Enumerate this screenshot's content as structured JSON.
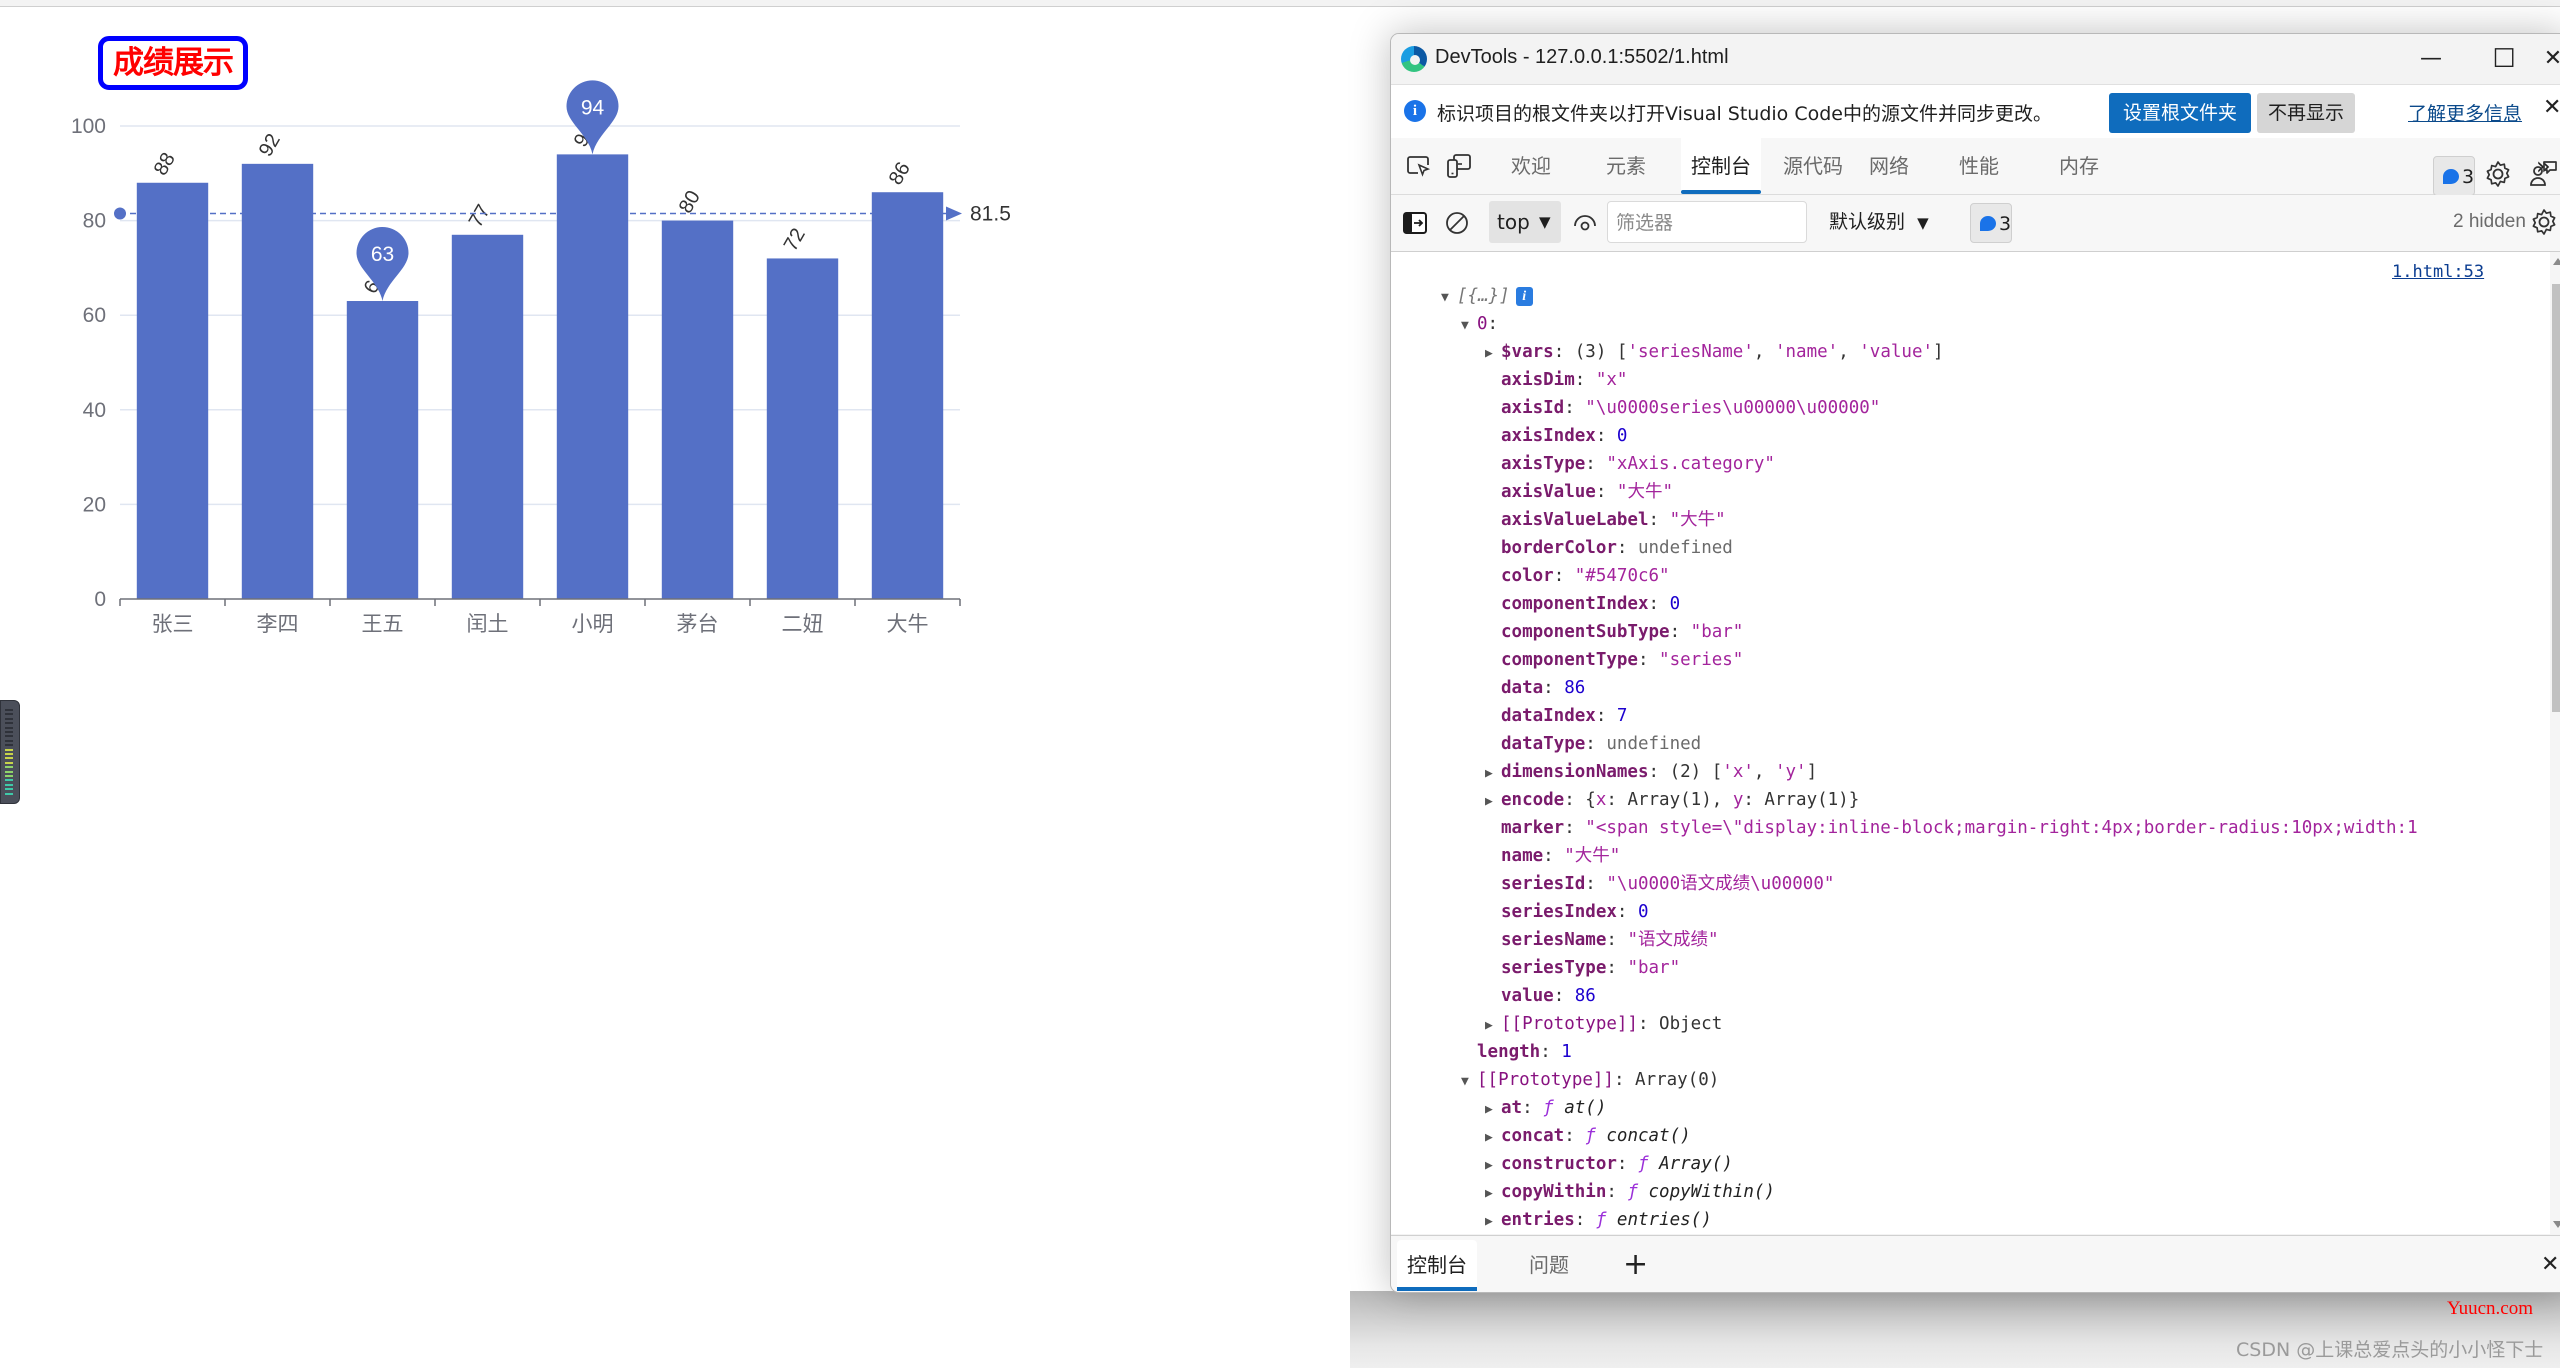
{
  "page": {
    "title_badge": "成绩展示"
  },
  "chart_data": {
    "type": "bar",
    "title": "成绩展示",
    "series_name": "语文成绩",
    "color": "#5470c6",
    "categories": [
      "张三",
      "李四",
      "王五",
      "闰土",
      "小明",
      "茅台",
      "二妞",
      "大牛"
    ],
    "values": [
      88,
      92,
      63,
      77,
      94,
      80,
      72,
      86
    ],
    "value_labels_rotated": true,
    "ylim": [
      0,
      100
    ],
    "yticks": [
      0,
      20,
      40,
      60,
      80,
      100
    ],
    "grid": true,
    "mark_points": [
      {
        "type": "min",
        "category": "王五",
        "value": 63,
        "label": "63"
      },
      {
        "type": "max",
        "category": "小明",
        "value": 94,
        "label": "94"
      }
    ],
    "mark_line": {
      "type": "average",
      "value": 81.5,
      "label": "81.5"
    },
    "xlabel": "",
    "ylabel": ""
  },
  "devtools": {
    "window_title": "DevTools - 127.0.0.1:5502/1.html",
    "window_buttons": {
      "minimize": "—",
      "maximize": "☐",
      "close": "✕"
    },
    "infobar": {
      "text": "标识项目的根文件夹以打开Visual Studio Code中的源文件并同步更改。",
      "primary_button": "设置根文件夹",
      "secondary_button": "不再显示",
      "link": "了解更多信息",
      "close": "✕"
    },
    "tabs": [
      {
        "label": "欢迎",
        "active": false
      },
      {
        "label": "元素",
        "active": false
      },
      {
        "label": "控制台",
        "active": true
      },
      {
        "label": "源代码",
        "active": false
      },
      {
        "label": "网络",
        "active": false
      },
      {
        "label": "性能",
        "active": false
      },
      {
        "label": "内存",
        "active": false
      }
    ],
    "more_tabs": "»",
    "add_tab": "+",
    "issues_count": "3",
    "more_menu": "···",
    "console_toolbar": {
      "context": "top",
      "filter_placeholder": "筛选器",
      "level": "默认级别",
      "messages_count": "3",
      "hidden": "2 hidden"
    },
    "console": {
      "source_link": "1.html:53",
      "lines": [
        {
          "indent": 0,
          "tri": "down",
          "parts": [
            {
              "t": "[{…}]",
              "c": "gi"
            }
          ],
          "info": true
        },
        {
          "indent": 1,
          "tri": "down",
          "parts": [
            {
              "t": "0",
              "c": "k"
            },
            {
              "t": ":",
              "c": "p"
            }
          ]
        },
        {
          "indent": 2,
          "tri": "right",
          "parts": [
            {
              "t": "$vars",
              "c": "k bold"
            },
            {
              "t": ": (3) [",
              "c": "p"
            },
            {
              "t": "'seriesName'",
              "c": "s"
            },
            {
              "t": ", ",
              "c": "p"
            },
            {
              "t": "'name'",
              "c": "s"
            },
            {
              "t": ", ",
              "c": "p"
            },
            {
              "t": "'value'",
              "c": "s"
            },
            {
              "t": "]",
              "c": "p"
            }
          ]
        },
        {
          "indent": 2,
          "tri": "none",
          "parts": [
            {
              "t": "axisDim",
              "c": "k bold"
            },
            {
              "t": ": ",
              "c": "p"
            },
            {
              "t": "\"x\"",
              "c": "s"
            }
          ]
        },
        {
          "indent": 2,
          "tri": "none",
          "parts": [
            {
              "t": "axisId",
              "c": "k bold"
            },
            {
              "t": ": ",
              "c": "p"
            },
            {
              "t": "\"\\u0000series\\u00000\\u00000\"",
              "c": "s"
            }
          ]
        },
        {
          "indent": 2,
          "tri": "none",
          "parts": [
            {
              "t": "axisIndex",
              "c": "k bold"
            },
            {
              "t": ": ",
              "c": "p"
            },
            {
              "t": "0",
              "c": "n"
            }
          ]
        },
        {
          "indent": 2,
          "tri": "none",
          "parts": [
            {
              "t": "axisType",
              "c": "k bold"
            },
            {
              "t": ": ",
              "c": "p"
            },
            {
              "t": "\"xAxis.category\"",
              "c": "s"
            }
          ]
        },
        {
          "indent": 2,
          "tri": "none",
          "parts": [
            {
              "t": "axisValue",
              "c": "k bold"
            },
            {
              "t": ": ",
              "c": "p"
            },
            {
              "t": "\"大牛\"",
              "c": "s"
            }
          ]
        },
        {
          "indent": 2,
          "tri": "none",
          "parts": [
            {
              "t": "axisValueLabel",
              "c": "k bold"
            },
            {
              "t": ": ",
              "c": "p"
            },
            {
              "t": "\"大牛\"",
              "c": "s"
            }
          ]
        },
        {
          "indent": 2,
          "tri": "none",
          "parts": [
            {
              "t": "borderColor",
              "c": "k bold"
            },
            {
              "t": ": ",
              "c": "p"
            },
            {
              "t": "undefined",
              "c": "u"
            }
          ]
        },
        {
          "indent": 2,
          "tri": "none",
          "parts": [
            {
              "t": "color",
              "c": "k bold"
            },
            {
              "t": ": ",
              "c": "p"
            },
            {
              "t": "\"#5470c6\"",
              "c": "s"
            }
          ]
        },
        {
          "indent": 2,
          "tri": "none",
          "parts": [
            {
              "t": "componentIndex",
              "c": "k bold"
            },
            {
              "t": ": ",
              "c": "p"
            },
            {
              "t": "0",
              "c": "n"
            }
          ]
        },
        {
          "indent": 2,
          "tri": "none",
          "parts": [
            {
              "t": "componentSubType",
              "c": "k bold"
            },
            {
              "t": ": ",
              "c": "p"
            },
            {
              "t": "\"bar\"",
              "c": "s"
            }
          ]
        },
        {
          "indent": 2,
          "tri": "none",
          "parts": [
            {
              "t": "componentType",
              "c": "k bold"
            },
            {
              "t": ": ",
              "c": "p"
            },
            {
              "t": "\"series\"",
              "c": "s"
            }
          ]
        },
        {
          "indent": 2,
          "tri": "none",
          "parts": [
            {
              "t": "data",
              "c": "k bold"
            },
            {
              "t": ": ",
              "c": "p"
            },
            {
              "t": "86",
              "c": "n"
            }
          ]
        },
        {
          "indent": 2,
          "tri": "none",
          "parts": [
            {
              "t": "dataIndex",
              "c": "k bold"
            },
            {
              "t": ": ",
              "c": "p"
            },
            {
              "t": "7",
              "c": "n"
            }
          ]
        },
        {
          "indent": 2,
          "tri": "none",
          "parts": [
            {
              "t": "dataType",
              "c": "k bold"
            },
            {
              "t": ": ",
              "c": "p"
            },
            {
              "t": "undefined",
              "c": "u"
            }
          ]
        },
        {
          "indent": 2,
          "tri": "right",
          "parts": [
            {
              "t": "dimensionNames",
              "c": "k bold"
            },
            {
              "t": ": (2) [",
              "c": "p"
            },
            {
              "t": "'x'",
              "c": "s"
            },
            {
              "t": ", ",
              "c": "p"
            },
            {
              "t": "'y'",
              "c": "s"
            },
            {
              "t": "]",
              "c": "p"
            }
          ]
        },
        {
          "indent": 2,
          "tri": "right",
          "parts": [
            {
              "t": "encode",
              "c": "k bold"
            },
            {
              "t": ": {",
              "c": "p"
            },
            {
              "t": "x",
              "c": "s"
            },
            {
              "t": ": Array(1), ",
              "c": "p"
            },
            {
              "t": "y",
              "c": "s"
            },
            {
              "t": ": Array(1)}",
              "c": "p"
            }
          ]
        },
        {
          "indent": 2,
          "tri": "none",
          "parts": [
            {
              "t": "marker",
              "c": "k bold"
            },
            {
              "t": ": ",
              "c": "p"
            },
            {
              "t": "\"<span style=\\\"display:inline-block;margin-right:4px;border-radius:10px;width:1",
              "c": "s"
            }
          ]
        },
        {
          "indent": 2,
          "tri": "none",
          "parts": [
            {
              "t": "name",
              "c": "k bold"
            },
            {
              "t": ": ",
              "c": "p"
            },
            {
              "t": "\"大牛\"",
              "c": "s"
            }
          ]
        },
        {
          "indent": 2,
          "tri": "none",
          "parts": [
            {
              "t": "seriesId",
              "c": "k bold"
            },
            {
              "t": ": ",
              "c": "p"
            },
            {
              "t": "\"\\u0000语文成绩\\u00000\"",
              "c": "s"
            }
          ]
        },
        {
          "indent": 2,
          "tri": "none",
          "parts": [
            {
              "t": "seriesIndex",
              "c": "k bold"
            },
            {
              "t": ": ",
              "c": "p"
            },
            {
              "t": "0",
              "c": "n"
            }
          ]
        },
        {
          "indent": 2,
          "tri": "none",
          "parts": [
            {
              "t": "seriesName",
              "c": "k bold"
            },
            {
              "t": ": ",
              "c": "p"
            },
            {
              "t": "\"语文成绩\"",
              "c": "s"
            }
          ]
        },
        {
          "indent": 2,
          "tri": "none",
          "parts": [
            {
              "t": "seriesType",
              "c": "k bold"
            },
            {
              "t": ": ",
              "c": "p"
            },
            {
              "t": "\"bar\"",
              "c": "s"
            }
          ]
        },
        {
          "indent": 2,
          "tri": "none",
          "parts": [
            {
              "t": "value",
              "c": "k bold"
            },
            {
              "t": ": ",
              "c": "p"
            },
            {
              "t": "86",
              "c": "n"
            }
          ]
        },
        {
          "indent": 2,
          "tri": "right",
          "parts": [
            {
              "t": "[[Prototype]]",
              "c": "k"
            },
            {
              "t": ": Object",
              "c": "p"
            }
          ]
        },
        {
          "indent": 1,
          "tri": "none",
          "parts": [
            {
              "t": "length",
              "c": "k bold"
            },
            {
              "t": ": ",
              "c": "p"
            },
            {
              "t": "1",
              "c": "n"
            }
          ]
        },
        {
          "indent": 1,
          "tri": "down",
          "parts": [
            {
              "t": "[[Prototype]]",
              "c": "k"
            },
            {
              "t": ": Array(0)",
              "c": "p"
            }
          ]
        },
        {
          "indent": 2,
          "tri": "right",
          "parts": [
            {
              "t": "at",
              "c": "k bold"
            },
            {
              "t": ": ",
              "c": "p"
            },
            {
              "t": "ƒ",
              "c": "f"
            },
            {
              "t": " at()",
              "c": "fi"
            }
          ]
        },
        {
          "indent": 2,
          "tri": "right",
          "parts": [
            {
              "t": "concat",
              "c": "k bold"
            },
            {
              "t": ": ",
              "c": "p"
            },
            {
              "t": "ƒ",
              "c": "f"
            },
            {
              "t": " concat()",
              "c": "fi"
            }
          ]
        },
        {
          "indent": 2,
          "tri": "right",
          "parts": [
            {
              "t": "constructor",
              "c": "k bold"
            },
            {
              "t": ": ",
              "c": "p"
            },
            {
              "t": "ƒ",
              "c": "f"
            },
            {
              "t": " Array()",
              "c": "fi"
            }
          ]
        },
        {
          "indent": 2,
          "tri": "right",
          "parts": [
            {
              "t": "copyWithin",
              "c": "k bold"
            },
            {
              "t": ": ",
              "c": "p"
            },
            {
              "t": "ƒ",
              "c": "f"
            },
            {
              "t": " copyWithin()",
              "c": "fi"
            }
          ]
        },
        {
          "indent": 2,
          "tri": "right",
          "parts": [
            {
              "t": "entries",
              "c": "k bold"
            },
            {
              "t": ": ",
              "c": "p"
            },
            {
              "t": "ƒ",
              "c": "f"
            },
            {
              "t": " entries()",
              "c": "fi"
            }
          ]
        }
      ]
    },
    "drawer": {
      "tabs": [
        {
          "label": "控制台",
          "active": true
        },
        {
          "label": "问题",
          "active": false
        }
      ],
      "add": "+",
      "close": "✕"
    }
  },
  "watermarks": {
    "site": "Yuucn.com",
    "author": "CSDN @上课总爱点头的小小怪下士"
  }
}
